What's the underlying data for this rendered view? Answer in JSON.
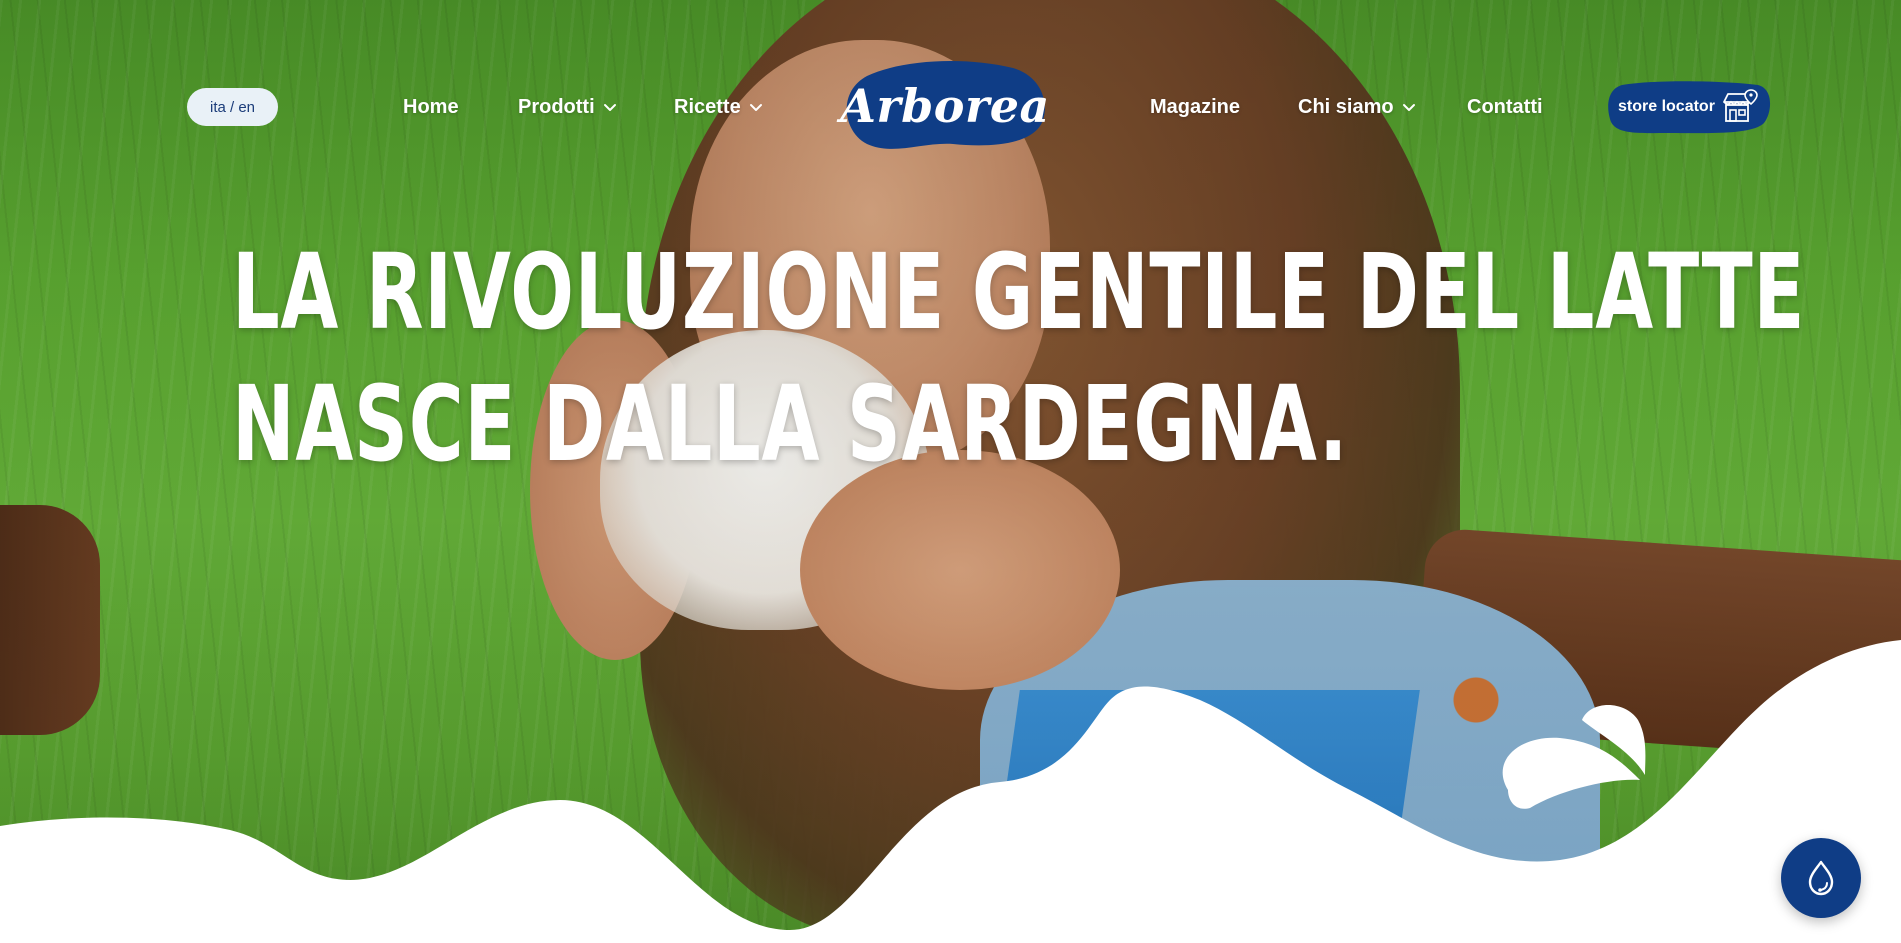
{
  "header": {
    "language_toggle": "ita / en",
    "nav_left": [
      {
        "label": "Home",
        "has_dropdown": false
      },
      {
        "label": "Prodotti",
        "has_dropdown": true
      },
      {
        "label": "Ricette",
        "has_dropdown": true
      }
    ],
    "logo_text": "Arborea",
    "nav_right": [
      {
        "label": "Magazine",
        "has_dropdown": false
      },
      {
        "label": "Chi siamo",
        "has_dropdown": true
      },
      {
        "label": "Contatti",
        "has_dropdown": false
      }
    ],
    "store_locator_label": "store locator",
    "store_locator_icon": "store-pin-icon"
  },
  "hero": {
    "headline_line1": "LA RIVOLUZIONE GENTILE DEL LATTE",
    "headline_line2": "NASCE DALLA SARDEGNA.",
    "background_image": "girl-drinking-milk-in-grass-photo"
  },
  "chat_button": {
    "icon": "milk-drop-headset-icon"
  },
  "colors": {
    "brand_blue": "#0f3d86",
    "lang_pill_bg": "#e9f1f7",
    "text_white": "#ffffff",
    "milk_white": "#ffffff"
  }
}
